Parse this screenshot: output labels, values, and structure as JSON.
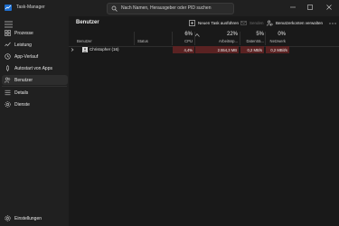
{
  "window": {
    "title": "Task-Manager"
  },
  "search": {
    "placeholder": "Nach Namen, Herausgeber oder PID suchen"
  },
  "nav": {
    "items": [
      {
        "label": "Prozesse",
        "icon": "grid-icon"
      },
      {
        "label": "Leistung",
        "icon": "performance-icon"
      },
      {
        "label": "App-Verlauf",
        "icon": "history-icon"
      },
      {
        "label": "Autostart von Apps",
        "icon": "startup-icon"
      },
      {
        "label": "Benutzer",
        "icon": "users-icon",
        "selected": true
      },
      {
        "label": "Details",
        "icon": "list-icon"
      },
      {
        "label": "Dienste",
        "icon": "services-icon"
      }
    ],
    "settings_label": "Einstellungen"
  },
  "page": {
    "title": "Benutzer"
  },
  "toolbar": {
    "new_task": "Neuen Task ausführen",
    "send": "Senden",
    "manage_accounts": "Benutzerkonten verwalten"
  },
  "table": {
    "columns": {
      "user": "Benutzer",
      "status": "Status",
      "cpu": {
        "pct": "6%",
        "label": "CPU"
      },
      "memory": {
        "pct": "22%",
        "label": "Arbeitssp..."
      },
      "disk": {
        "pct": "5%",
        "label": "Datenträ..."
      },
      "network": {
        "pct": "0%",
        "label": "Netzwerk"
      }
    },
    "rows": [
      {
        "name": "Christopher (16)",
        "cpu": "4,4%",
        "memory": "2.554,3 MB",
        "disk": "0,2 MB/s",
        "network": "0,2 MBit/s"
      }
    ]
  },
  "colors": {
    "heat": "#5a2222",
    "accent": "#3a6fd8"
  }
}
